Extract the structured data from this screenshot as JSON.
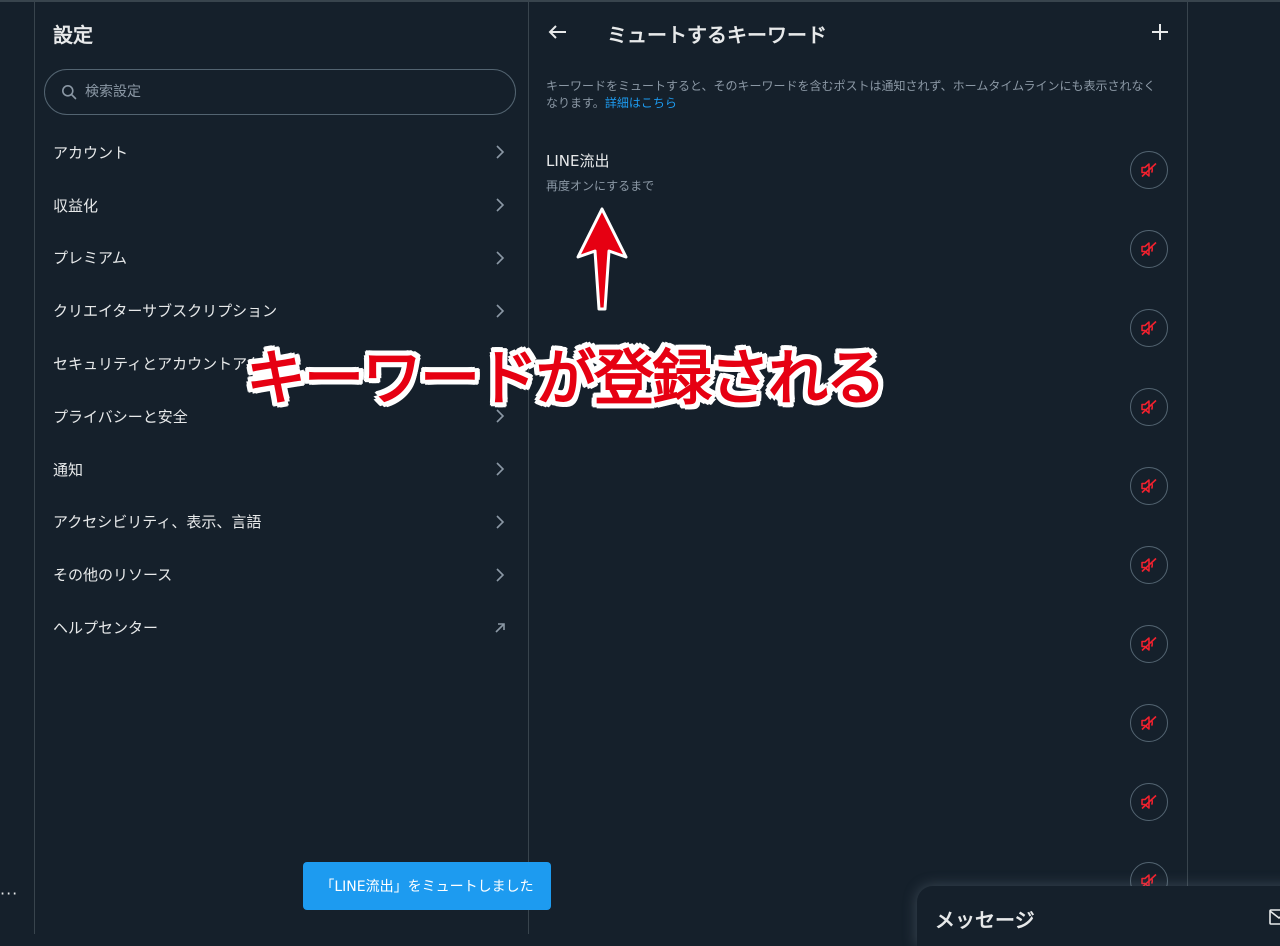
{
  "settings": {
    "title": "設定",
    "search_placeholder": "検索設定",
    "menu": [
      {
        "label": "アカウント",
        "icon": "chevron-right-icon"
      },
      {
        "label": "収益化",
        "icon": "chevron-right-icon"
      },
      {
        "label": "プレミアム",
        "icon": "chevron-right-icon"
      },
      {
        "label": "クリエイターサブスクリプション",
        "icon": "chevron-right-icon"
      },
      {
        "label": "セキュリティとアカウントアクセス",
        "icon": "chevron-right-icon"
      },
      {
        "label": "プライバシーと安全",
        "icon": "chevron-right-icon"
      },
      {
        "label": "通知",
        "icon": "chevron-right-icon"
      },
      {
        "label": "アクセシビリティ、表示、言語",
        "icon": "chevron-right-icon"
      },
      {
        "label": "その他のリソース",
        "icon": "chevron-right-icon"
      },
      {
        "label": "ヘルプセンター",
        "icon": "external-link-icon"
      }
    ]
  },
  "keywords": {
    "title": "ミュートするキーワード",
    "description": "キーワードをミュートすると、そのキーワードを含むポストは通知されず、ホームタイムラインにも表示されなくなります。",
    "details_link": "詳細はこちら",
    "items": [
      {
        "keyword": "LINE流出",
        "duration": "再度オンにするまで"
      }
    ]
  },
  "annotation": {
    "caption": "キーワードが登録される"
  },
  "toast": {
    "message": "「LINE流出」をミュートしました"
  },
  "messages": {
    "title": "メッセージ"
  },
  "colors": {
    "background": "#15202b",
    "accent": "#1d9bf0",
    "muted_icon": "#f4212e",
    "annotation": "#e60012"
  }
}
